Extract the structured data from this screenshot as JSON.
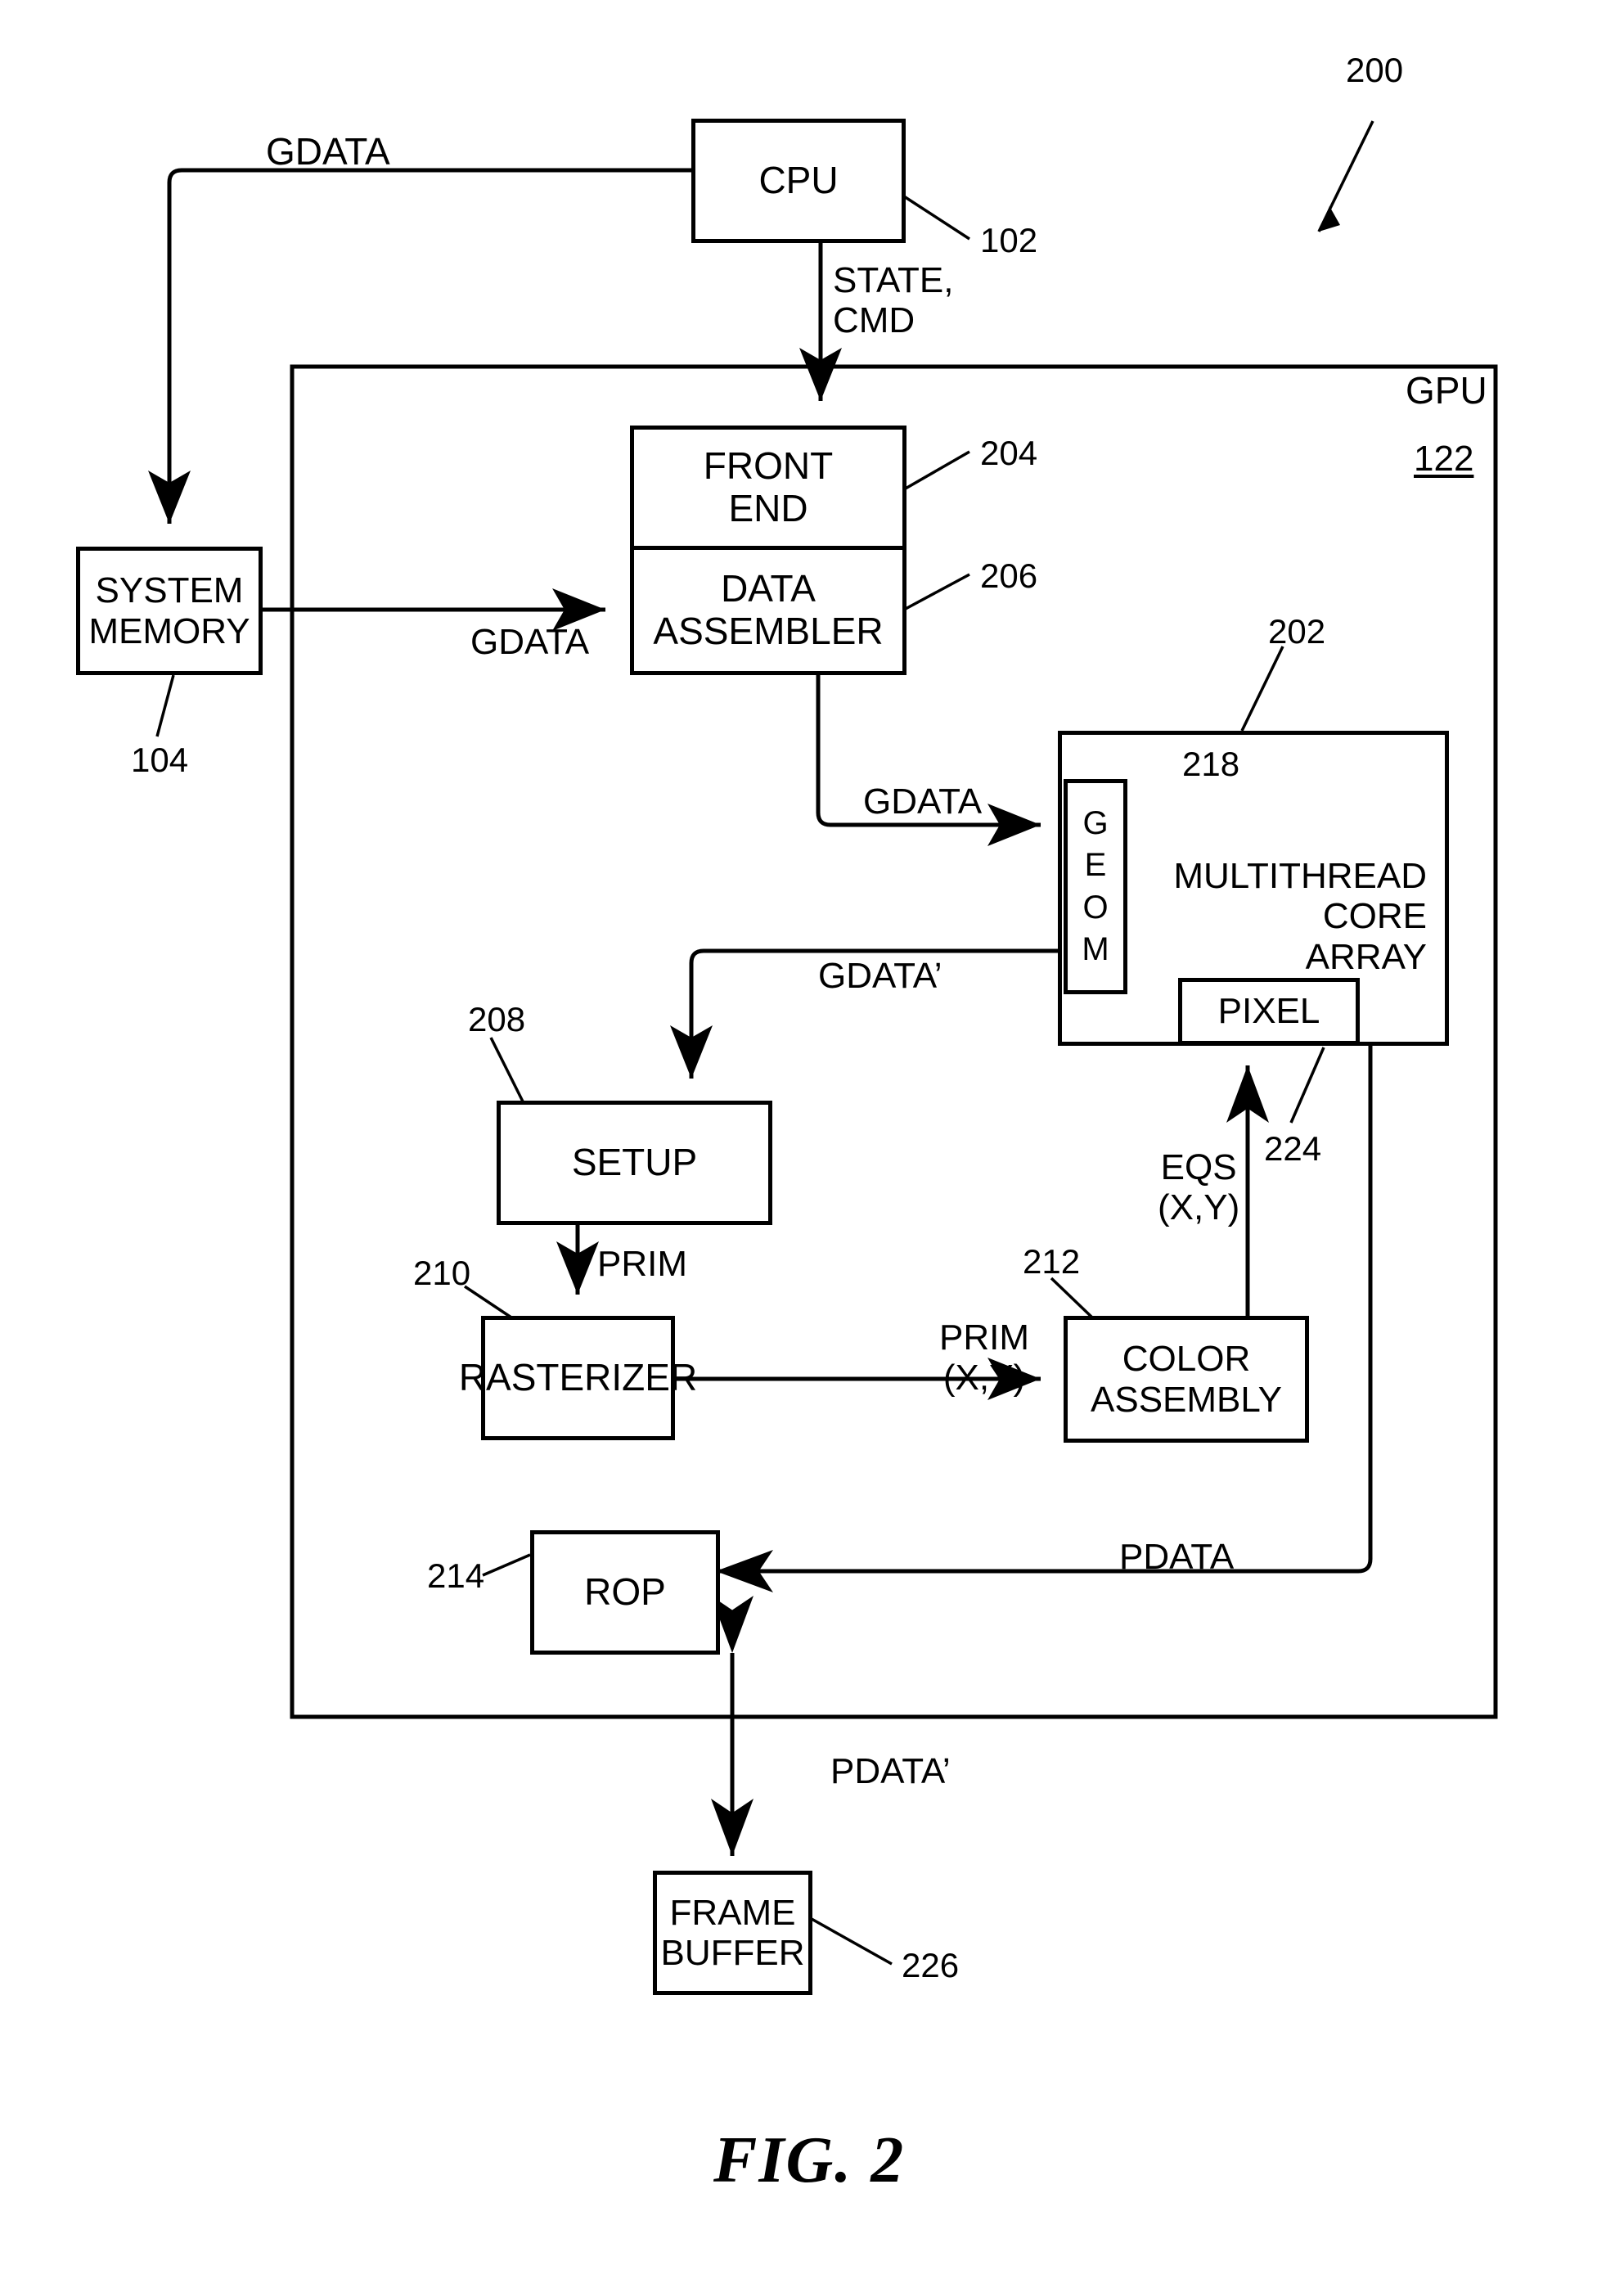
{
  "figure": {
    "caption": "FIG. 2",
    "system_ref": "200"
  },
  "blocks": {
    "cpu": {
      "label": "CPU",
      "ref": "102"
    },
    "system_memory": {
      "line1": "SYSTEM",
      "line2": "MEMORY",
      "ref": "104"
    },
    "gpu": {
      "label": "GPU",
      "ref": "122"
    },
    "front_end": {
      "line1": "FRONT",
      "line2": "END",
      "ref": "204"
    },
    "data_assembler": {
      "line1": "DATA",
      "line2": "ASSEMBLER",
      "ref": "206"
    },
    "core_array": {
      "line1": "MULTITHREAD",
      "line2": "CORE",
      "line3": "ARRAY",
      "ref": "202"
    },
    "geom": {
      "l1": "G",
      "l2": "E",
      "l3": "O",
      "l4": "M",
      "ref": "218"
    },
    "pixel": {
      "label": "PIXEL",
      "ref": "224"
    },
    "setup": {
      "label": "SETUP",
      "ref": "208"
    },
    "rasterizer": {
      "label": "RASTERIZER",
      "ref": "210"
    },
    "color_assembly": {
      "line1": "COLOR",
      "line2": "ASSEMBLY",
      "ref": "212"
    },
    "rop": {
      "label": "ROP",
      "ref": "214"
    },
    "frame_buffer": {
      "line1": "FRAME",
      "line2": "BUFFER",
      "ref": "226"
    }
  },
  "signals": {
    "gdata_cpu_to_mem": "GDATA",
    "state_cmd": {
      "line1": "STATE,",
      "line2": "CMD"
    },
    "gdata_mem_to_da": "GDATA",
    "gdata_da_to_geom": "GDATA",
    "gdata_prime": "GDATA’",
    "prim_setup_to_rast": "PRIM",
    "prim_xy": {
      "line1": "PRIM",
      "line2": "(X,Y)"
    },
    "eqs_xy": {
      "line1": "EQS",
      "line2": "(X,Y)"
    },
    "pdata": "PDATA",
    "pdata_prime": "PDATA’"
  },
  "colors": {
    "ink": "#000000",
    "paper": "#ffffff"
  }
}
